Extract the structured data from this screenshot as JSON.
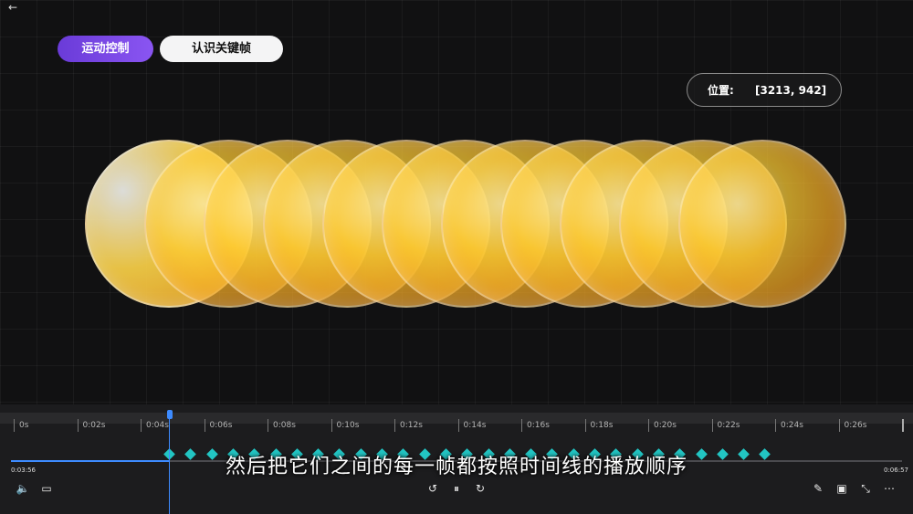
{
  "nav": {
    "back_icon": "arrow-left-icon",
    "back_glyph": "←"
  },
  "tabs": [
    {
      "label": "运动控制",
      "active": true,
      "color": "#7c4dee"
    },
    {
      "label": "认识关键帧",
      "active": false,
      "color": "#f4f4f5"
    }
  ],
  "position_display": {
    "label": "位置:",
    "value": "[3213, 942]"
  },
  "scene": {
    "ball_count": 11,
    "ball_color": "#f5b02a"
  },
  "timeline": {
    "ruler_ticks": [
      "0s",
      "0:02s",
      "0:04s",
      "0:06s",
      "0:08s",
      "0:10s",
      "0:12s",
      "0:14s",
      "0:16s",
      "0:18s",
      "0:20s",
      "0:22s",
      "0:24s",
      "0:26s"
    ],
    "keyframe_count": 29,
    "keyframe_color": "#22c5c3",
    "playhead_color": "#3d8bff"
  },
  "player": {
    "current_time": "0:03:56",
    "total_time": "0:06:57",
    "progress_fraction": 0.177,
    "subtitle": "然后把它们之间的每一帧都按照时间线的播放顺序"
  },
  "controls": {
    "volume_icon": "volume-icon",
    "subtitles_icon": "subtitles-icon",
    "rewind_icon": "rewind-10-icon",
    "pause_icon": "pause-icon",
    "forward_icon": "forward-30-icon",
    "edit_icon": "pencil-icon",
    "miniplayer_icon": "miniplayer-icon",
    "collapse_icon": "collapse-icon",
    "more_icon": "more-icon",
    "glyphs": {
      "volume": "🔈",
      "subtitles": "▭",
      "rewind": "↺",
      "pause": "⏸",
      "forward": "↻",
      "edit": "✎",
      "miniplayer": "▣",
      "collapse": "⤡",
      "more": "⋯"
    }
  }
}
